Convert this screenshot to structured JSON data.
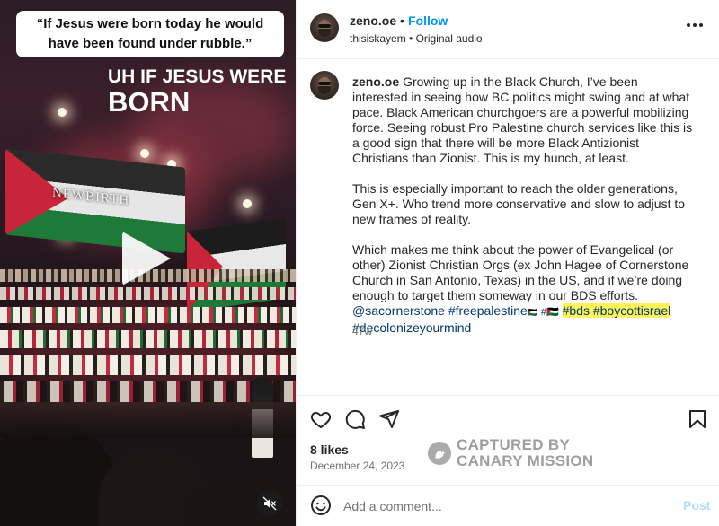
{
  "media": {
    "quote_line1": "“If Jesus were born today he would",
    "quote_line2": "have been found under rubble.”",
    "overlay_line1": "UH IF JESUS WERE",
    "overlay_line2": "BORN",
    "screen_text": "NEWBIRTH",
    "icons": {
      "play": "play-icon",
      "mute": "mute-icon"
    }
  },
  "header": {
    "username": "zeno.oe",
    "separator": "•",
    "follow_label": "Follow",
    "sub_account": "thisiskayem",
    "sub_separator": " • ",
    "sub_audio": "Original audio"
  },
  "caption": {
    "username": "zeno.oe",
    "para1": "Growing up in the Black Church, I’ve been interested in seeing how BC politics might swing and at what pace. Black American churchgoers are a powerful mobilizing force. Seeing robust Pro Palestine church services like this is a good sign that there will be more Black Antizionist Christians than Zionist. This is my hunch, at least.",
    "para2": "This is especially important to reach the older generations, Gen X+. Who trend more conservative and slow to adjust to new frames of reality.",
    "para3": "Which makes me think about the power of Evangelical (or other) Zionist Christian Orgs (ex John Hagee of Cornerstone Church in San Antonio, Texas) in the US, and if we’re doing enough to target them someway in our BDS efforts.",
    "mention": "@sacornerstone",
    "tag_free": "#freepalestine",
    "tag_free_suffix": "🇵🇸",
    "tag_ps": "#🇵🇸",
    "tag_bds": "#bds",
    "tag_boycott": "#boycottisrael",
    "tag_decolonize": "#decolonizeyourmind",
    "time_ago": "47w"
  },
  "actions": {
    "icons": [
      "heart-icon",
      "comment-icon",
      "share-icon",
      "bookmark-icon"
    ],
    "likes": "8 likes",
    "date": "December 24, 2023"
  },
  "watermark": {
    "line1": "CAPTURED BY",
    "line2": "CANARY MISSION"
  },
  "comment_box": {
    "placeholder": "Add a comment...",
    "post_label": "Post"
  },
  "colors": {
    "link_blue": "#0095f6",
    "hashtag": "#00376b",
    "highlight": "#fff35c",
    "muted": "#737373"
  }
}
